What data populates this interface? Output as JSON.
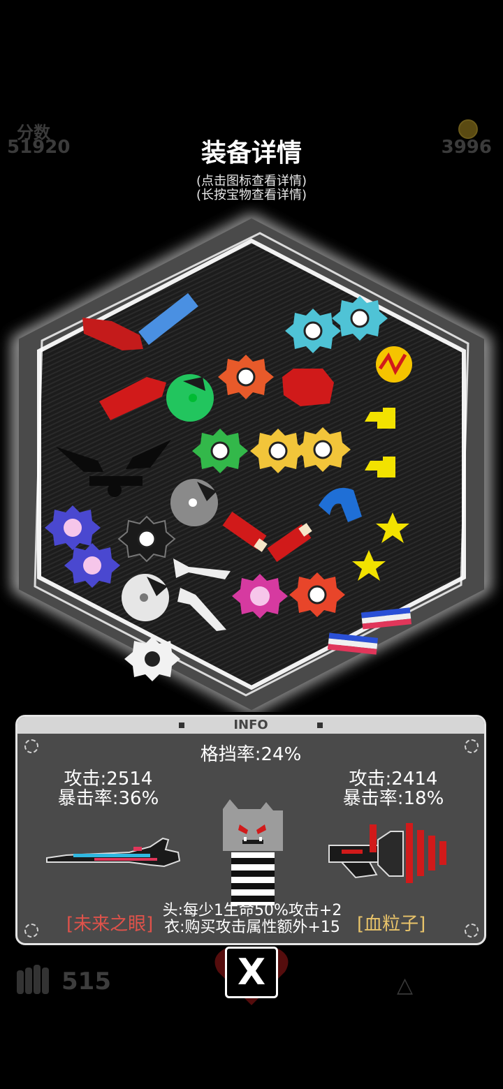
{
  "hud": {
    "score_label": "分数",
    "score_value": "51920",
    "coins": "3996",
    "ammo": "515"
  },
  "dialog": {
    "title": "装备详情",
    "hint_tap": "(点击图标查看详情)",
    "hint_hold": "(长按宝物查看详情)"
  },
  "info": {
    "header": "INFO",
    "block_rate": "格挡率:24%",
    "left": {
      "attack": "攻击:2514",
      "crit": "暴击率:36%",
      "name": "[未来之眼]"
    },
    "right": {
      "attack": "攻击:2414",
      "crit": "暴击率:18%",
      "name": "[血粒子]"
    },
    "effect_head": "头:每少1生命50%攻击+2",
    "effect_body": "衣:购买攻击属性额外+15"
  },
  "close": {
    "label": "X"
  },
  "colors": {
    "panel_bg": "#4a4a4a",
    "left_name": "#e0524a",
    "right_name": "#e9c46a"
  },
  "icons": {
    "treasure_items": [
      "red-slab",
      "blue-bar",
      "red-wedge",
      "green-orb",
      "orange-gear",
      "red-octagon",
      "cyan-gear",
      "cyan-gear",
      "yellow-zigzag-coin",
      "yellow-block",
      "yellow-block",
      "green-gear",
      "yellow-gear",
      "yellow-gear",
      "black-angry-eyes",
      "black-mustache",
      "grey-orb",
      "blue-arch",
      "red-bone",
      "red-bone",
      "yellow-star",
      "yellow-star",
      "purple-gear",
      "pink-gear",
      "black-gear",
      "white-orb",
      "white-bowtie",
      "white-bowtie",
      "magenta-gear",
      "red-gear",
      "flag-bar",
      "flag-bar",
      "white-gear"
    ]
  }
}
